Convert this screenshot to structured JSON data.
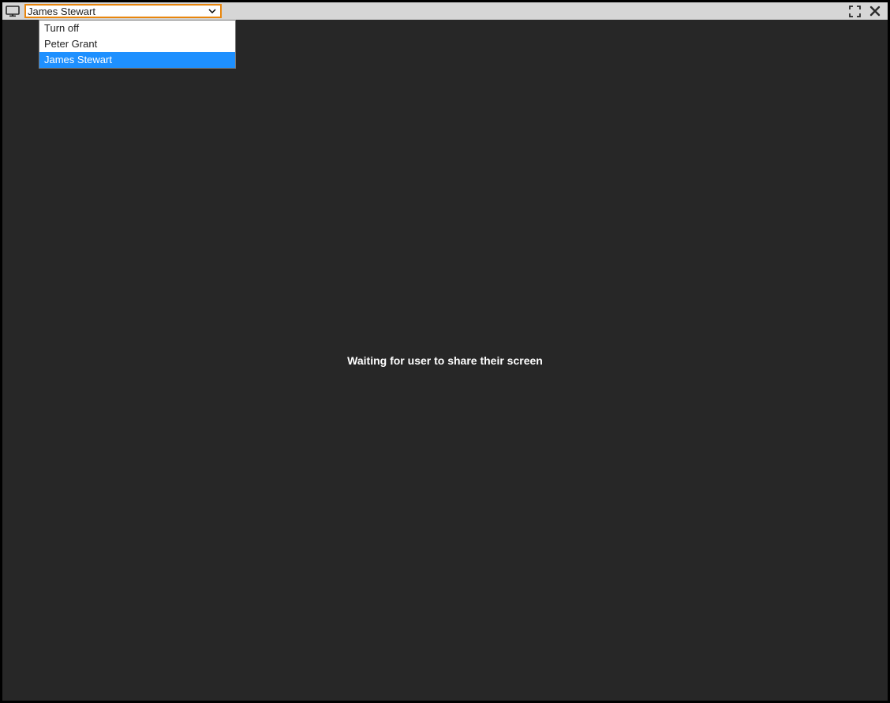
{
  "toolbar": {
    "selected_user": "James Stewart",
    "options": [
      {
        "label": "Turn off",
        "selected": false
      },
      {
        "label": "Peter Grant",
        "selected": false
      },
      {
        "label": "James Stewart",
        "selected": true
      }
    ]
  },
  "main": {
    "status_text": "Waiting for user to share their screen"
  }
}
